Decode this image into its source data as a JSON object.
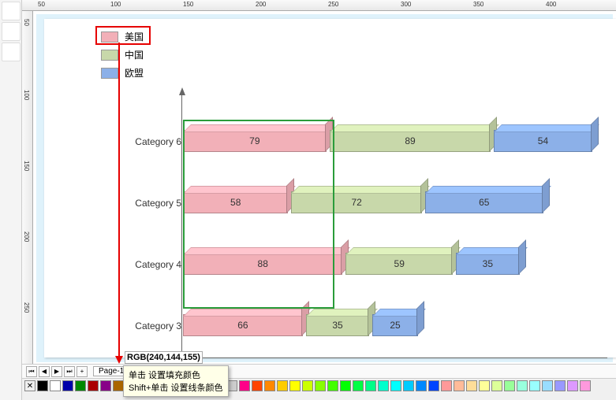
{
  "legend": [
    {
      "label": "美国",
      "color": "#f2b0b8"
    },
    {
      "label": "中国",
      "color": "#c8d8aa"
    },
    {
      "label": "欧盟",
      "color": "#8cb0e8"
    }
  ],
  "chart_data": {
    "type": "bar",
    "orientation": "horizontal-stacked",
    "categories": [
      "Category 6",
      "Category 5",
      "Category 4",
      "Category 3"
    ],
    "series": [
      {
        "name": "美国",
        "values": [
          79,
          58,
          88,
          66
        ],
        "color": "#f2b0b8"
      },
      {
        "name": "中国",
        "values": [
          89,
          72,
          59,
          35
        ],
        "color": "#c8d8aa"
      },
      {
        "name": "欧盟",
        "values": [
          54,
          65,
          35,
          25
        ],
        "color": "#8cb0e8"
      }
    ],
    "xlabel": "",
    "ylabel": "",
    "title": ""
  },
  "rgb_label": "RGB(240,144,155)",
  "tooltip": {
    "line1": "单击 设置填充颜色",
    "line2": "Shift+单击 设置线条颜色"
  },
  "page_label": "Page-1",
  "palette": [
    "#000",
    "#fff",
    "#00a",
    "#080",
    "#a00",
    "#808",
    "#a60",
    "#888",
    "#444",
    "#ccf",
    "#cfc",
    "#fcc",
    "#fcf",
    "#ffc",
    "#cff",
    "#ccc",
    "#f08",
    "#f40",
    "#f80",
    "#fc0",
    "#ff0",
    "#cf0",
    "#8f0",
    "#4f0",
    "#0f0",
    "#0f4",
    "#0f8",
    "#0fc",
    "#0ff",
    "#0cf",
    "#08f",
    "#04f",
    "#f99",
    "#fb9",
    "#fd9",
    "#ff9",
    "#df9",
    "#9f9",
    "#9fd",
    "#9ff",
    "#9df",
    "#99f",
    "#d9f",
    "#f9d"
  ],
  "ruler_h": [
    "50",
    "100",
    "150",
    "200",
    "250",
    "300",
    "350",
    "400"
  ],
  "ruler_v": [
    "50",
    "100",
    "150",
    "200",
    "250"
  ]
}
